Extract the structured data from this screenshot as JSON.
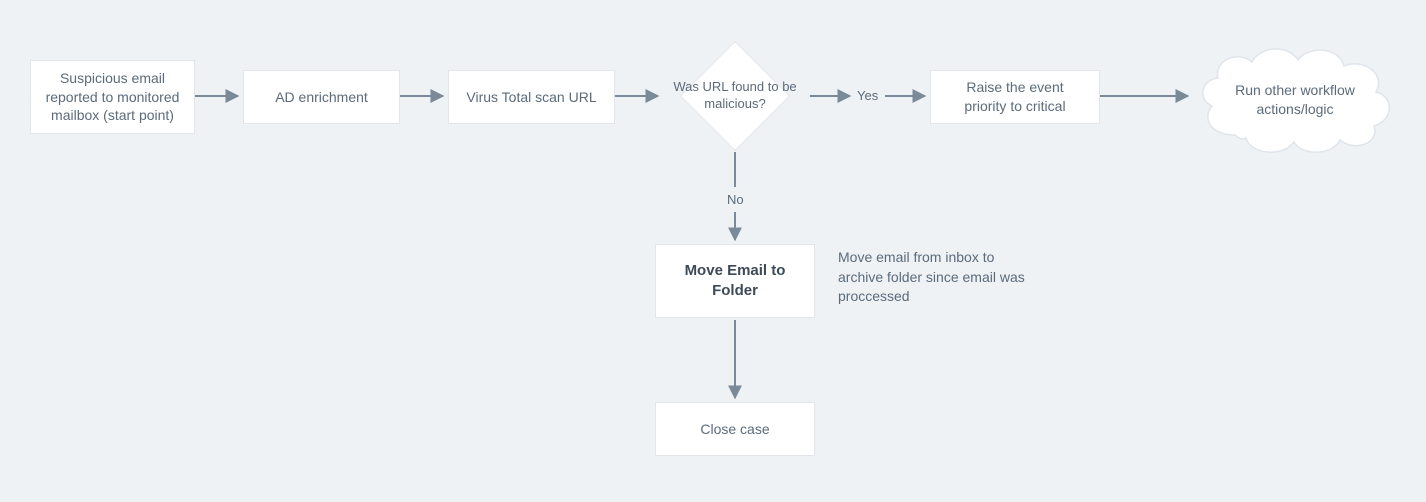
{
  "diagram": {
    "nodes": {
      "start": "Suspicious email reported to monitored mailbox (start point)",
      "ad": "AD enrichment",
      "vt": "Virus Total scan URL",
      "decision": "Was URL found to be malicious?",
      "raise": "Raise the event priority to critical",
      "cloud": "Run other workflow actions/logic",
      "move": "Move Email to Folder",
      "close": "Close case"
    },
    "edge_labels": {
      "yes": "Yes",
      "no": "No"
    },
    "annotation": "Move email from inbox to archive folder since email was proccessed"
  },
  "chart_data": {
    "type": "flowchart",
    "nodes": [
      {
        "id": "start",
        "type": "process",
        "label": "Suspicious email reported to monitored mailbox (start point)"
      },
      {
        "id": "ad",
        "type": "process",
        "label": "AD enrichment"
      },
      {
        "id": "vt",
        "type": "process",
        "label": "Virus Total scan URL"
      },
      {
        "id": "decision",
        "type": "decision",
        "label": "Was URL found to be malicious?"
      },
      {
        "id": "raise",
        "type": "process",
        "label": "Raise the event priority to critical"
      },
      {
        "id": "cloud",
        "type": "terminator",
        "label": "Run other workflow actions/logic"
      },
      {
        "id": "move",
        "type": "process",
        "label": "Move Email to Folder",
        "annotation": "Move email from inbox to archive folder since email was proccessed"
      },
      {
        "id": "close",
        "type": "process",
        "label": "Close case"
      }
    ],
    "edges": [
      {
        "from": "start",
        "to": "ad"
      },
      {
        "from": "ad",
        "to": "vt"
      },
      {
        "from": "vt",
        "to": "decision"
      },
      {
        "from": "decision",
        "to": "raise",
        "label": "Yes"
      },
      {
        "from": "raise",
        "to": "cloud"
      },
      {
        "from": "decision",
        "to": "move",
        "label": "No"
      },
      {
        "from": "move",
        "to": "close"
      }
    ]
  }
}
